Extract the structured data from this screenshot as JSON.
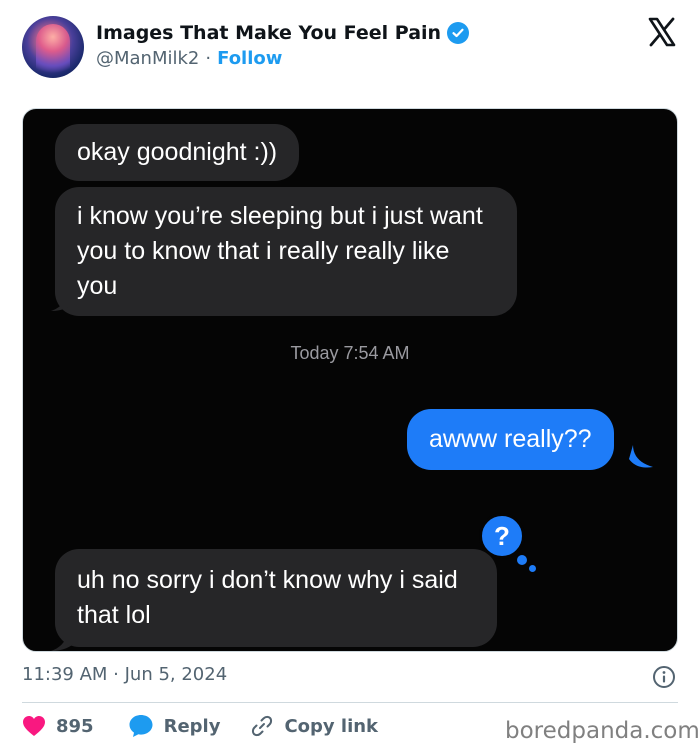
{
  "tweet": {
    "display_name": "Images That Make You Feel Pain",
    "handle": "@ManMilk2",
    "separator": "·",
    "follow_label": "Follow",
    "timestamp": "11:39 AM · Jun 5, 2024"
  },
  "messages": {
    "msg1": "okay goodnight :))",
    "msg2": "i know you’re sleeping but i just want you to know that i really really like you",
    "time": "Today 7:54 AM",
    "msg3": "awww really??",
    "reaction": "?",
    "msg4": "uh no sorry i don’t know why i said that lol"
  },
  "actions": {
    "likes": "895",
    "reply_label": "Reply",
    "copy_label": "Copy link"
  },
  "watermark": "boredpanda.com",
  "colors": {
    "accent": "#1d9bf0",
    "like": "#f91880",
    "imessage_blue": "#1e7cf8",
    "imessage_gray": "#262628"
  },
  "icons": [
    "verified-badge-icon",
    "x-logo-icon",
    "info-icon",
    "heart-icon",
    "reply-bubble-icon",
    "link-icon"
  ]
}
